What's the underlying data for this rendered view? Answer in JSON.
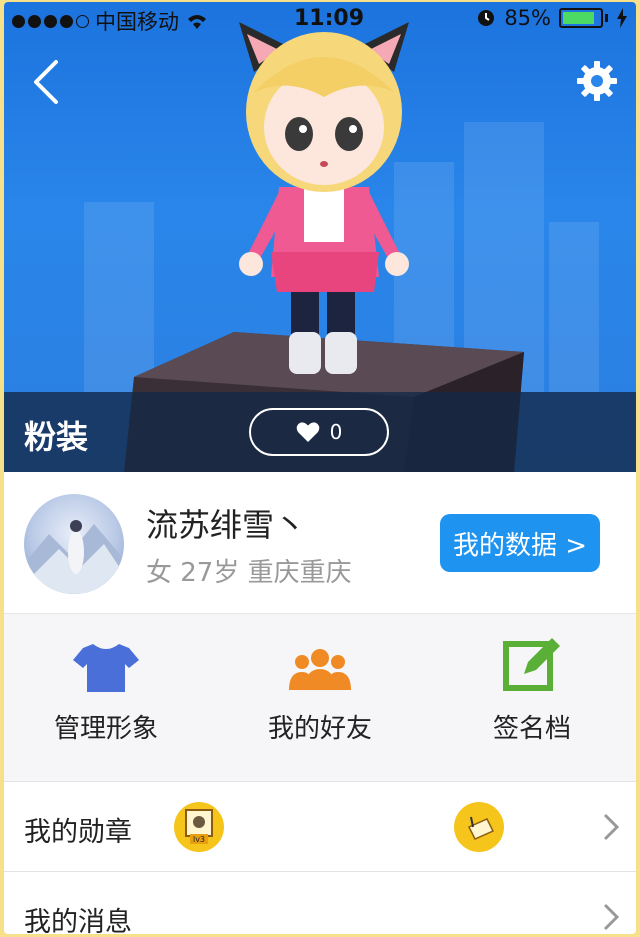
{
  "status_bar": {
    "carrier": "中国移动",
    "time": "11:09",
    "battery_percent": "85%",
    "battery_level": 0.85
  },
  "hero": {
    "outfit_name": "粉装",
    "like_count": "0"
  },
  "profile": {
    "username": "流苏绯雪丶",
    "info": "女 27岁 重庆重庆",
    "data_button_label": "我的数据 >"
  },
  "actions": [
    {
      "label": "管理形象",
      "icon": "tshirt-icon",
      "color": "#4a6fd8"
    },
    {
      "label": "我的好友",
      "icon": "friends-icon",
      "color": "#f08a24"
    },
    {
      "label": "签名档",
      "icon": "edit-icon",
      "color": "#5ab036"
    }
  ],
  "list": {
    "medals_label": "我的勋章",
    "medal_badge_text": "lv3",
    "messages_label": "我的消息"
  },
  "colors": {
    "accent": "#1f93f0",
    "badge": "#f6c51c"
  }
}
